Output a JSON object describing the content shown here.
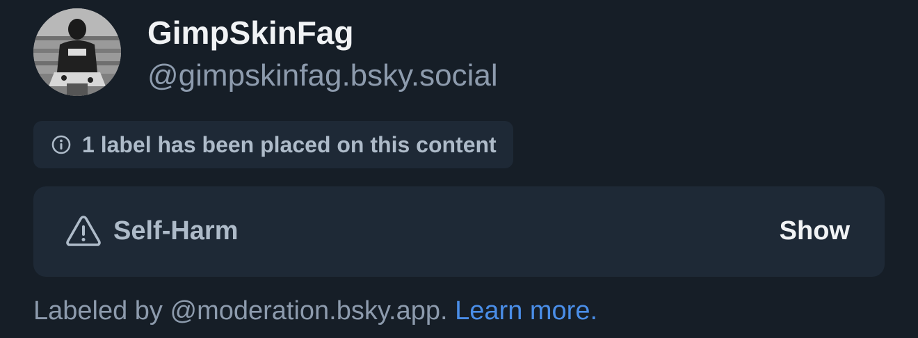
{
  "profile": {
    "display_name": "GimpSkinFag",
    "handle": "@gimpskinfag.bsky.social",
    "avatar_icon": "profile-photo"
  },
  "labels_notice": {
    "text": "1 label has been placed on this content",
    "icon": "info-circle-icon"
  },
  "warning": {
    "icon": "warning-triangle-icon",
    "label": "Self-Harm",
    "show_label": "Show"
  },
  "footer": {
    "prefix": "Labeled by @moderation.bsky.app.",
    "link_text": "Learn more."
  },
  "colors": {
    "background": "#161e27",
    "card": "#1e2936",
    "text_primary": "#f1f3f5",
    "text_secondary": "#8d9bad",
    "link": "#4a8ee8"
  }
}
